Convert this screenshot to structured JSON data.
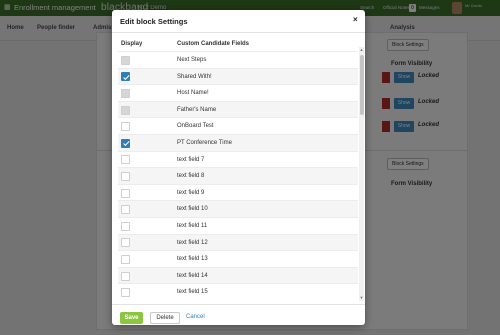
{
  "topbar": {
    "grid_icon": "grid-icon",
    "app_name": "Enrollment management",
    "logo": "blackbaud",
    "school": "K12 Demo",
    "search": "Search",
    "official_notes": "Official Notes",
    "messages_count": "0",
    "messages": "Messages",
    "user": "Mr Gordo"
  },
  "nav": {
    "home": "Home",
    "people_finder": "People finder",
    "admissions": "Admissions",
    "analysis": "Analysis"
  },
  "background": {
    "block_settings_1": "Block Settings",
    "block_settings_2": "Block Settings",
    "form_visibility_1": "Form Visibility",
    "form_visibility_2": "Form Visibility",
    "show": "Show",
    "locked": "Locked"
  },
  "modal": {
    "title": "Edit block Settings",
    "close": "×",
    "col_display": "Display",
    "col_fields": "Custom Candidate Fields",
    "rows": [
      {
        "label": "Next Steps",
        "state": "disabled"
      },
      {
        "label": "Shared With!",
        "state": "checked"
      },
      {
        "label": "Host Name!",
        "state": "disabled"
      },
      {
        "label": "Father's Name",
        "state": "disabled"
      },
      {
        "label": "OnBoard Test",
        "state": "empty"
      },
      {
        "label": "PT Conference Time",
        "state": "checked"
      },
      {
        "label": "text field 7",
        "state": "empty"
      },
      {
        "label": "text field 8",
        "state": "empty"
      },
      {
        "label": "text field 9",
        "state": "empty"
      },
      {
        "label": "text field 10",
        "state": "empty"
      },
      {
        "label": "text field 11",
        "state": "empty"
      },
      {
        "label": "text field 12",
        "state": "empty"
      },
      {
        "label": "text field 13",
        "state": "empty"
      },
      {
        "label": "text field 14",
        "state": "empty"
      },
      {
        "label": "text field 15",
        "state": "empty"
      }
    ],
    "save": "Save",
    "delete": "Delete",
    "cancel": "Cancel"
  },
  "colors": {
    "topbar": "#3c6e2a",
    "accent_blue": "#2e7fb8",
    "save_green": "#8cc63e",
    "danger_red": "#b52a2a"
  }
}
